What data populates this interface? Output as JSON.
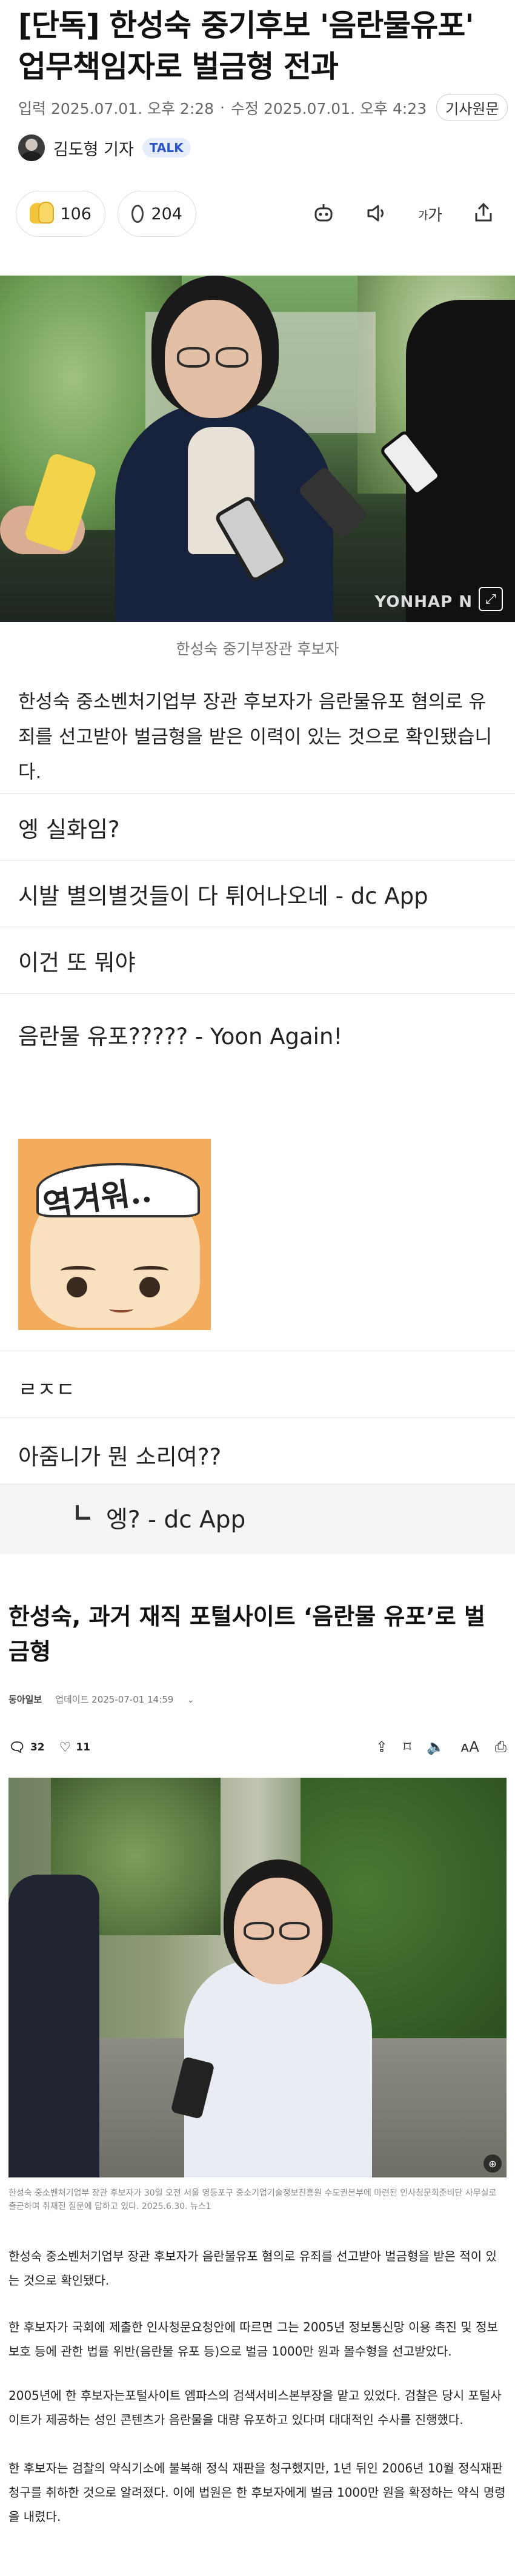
{
  "article1": {
    "title": "[단독] 한성숙 중기후보 '음란물유포' 업무책임자로 벌금형 전과",
    "input_date": "입력 2025.07.01. 오후 2:28",
    "edit_date": "수정 2025.07.01. 오후 4:23",
    "source_button": "기사원문",
    "reporter": "김도형 기자",
    "talk_badge": "TALK",
    "reaction_count": "106",
    "comment_count": "204",
    "photo_credit": "YONHAP N",
    "photo_caption": "한성숙 중기부장관 후보자",
    "lede": "한성숙 중소벤처기업부 장관 후보자가 음란물유포 혐의로 유죄를 선고받아 벌금형을 받은 이력이 있는 것으로 확인됐습니다."
  },
  "comments": [
    "엥 실화임?",
    "시발 별의별것들이 다 튀어나오네 - dc App",
    "이건 또 뭐야",
    "음란물 유포????? - Yoon Again!",
    "ㄹㅈㄷ",
    "아줌니가 뭔 소리여??"
  ],
  "sticker_text": "역겨워..",
  "reply": "엥? - dc App",
  "article2": {
    "title": "한성숙, 과거 재직 포털사이트 ‘음란물 유포’로 벌금형",
    "publisher": "동아일보",
    "updated": "업데이트 2025-07-01 14:59",
    "like_count": "32",
    "heart_count": "11",
    "photo_caption": "한성숙 중소벤처기업부 장관 후보자가 30일 오전 서울 영등포구 중소기업기술정보진흥원 수도권본부에 마련된 인사청문회준비단 사무실로 출근하며 취재진 질문에 답하고 있다. 2025.6.30. 뉴스1",
    "paragraphs": [
      "한성숙 중소벤처기업부 장관 후보자가 음란물유포 혐의로 유죄를 선고받아 벌금형을 받은 적이 있는 것으로 확인됐다.",
      "한 후보자가 국회에 제출한 인사청문요청안에 따르면 그는 2005년 정보통신망 이용 촉진 및 정보보호 등에 관한 법률 위반(음란물 유포 등)으로 벌금 1000만 원과 몰수형을 선고받았다.",
      "2005년에 한 후보자는포털사이트 엠파스의 검색서비스본부장을 맡고 있었다. 검찰은 당시 포털사이트가 제공하는 성인 콘텐츠가 음란물을 대량 유포하고 있다며 대대적인 수사를 진행했다.",
      "한 후보자는 검찰의 약식기소에 불복해 정식 재판을 청구했지만, 1년 뒤인 2006년 10월 정식재판 청구를 취하한 것으로 알려졌다. 이에 법원은 한 후보자에게 벌금 1000만 원을 확정하는 약식 명령을 내렸다."
    ]
  },
  "colors": {
    "text": "#222222",
    "muted": "#777777",
    "talk": "#2a54c9",
    "divider": "#e3e3e3"
  }
}
